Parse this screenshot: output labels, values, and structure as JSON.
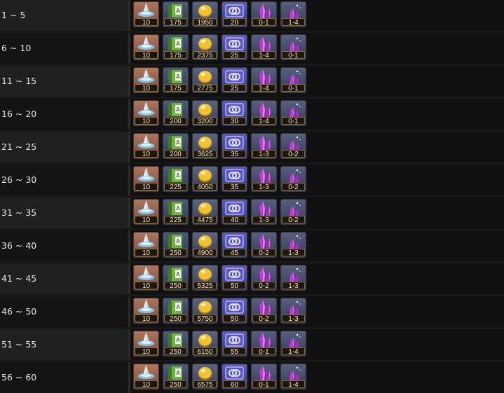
{
  "items": [
    {
      "icon": "crystal-shard-icon"
    },
    {
      "icon": "skill-book-icon"
    },
    {
      "icon": "gold-coin-icon"
    },
    {
      "icon": "portal-ticket-icon"
    },
    {
      "icon": "pink-crystal-large-icon"
    },
    {
      "icon": "pink-crystal-small-icon"
    }
  ],
  "rows": [
    {
      "range": "1 ~ 5",
      "values": [
        "10",
        "175",
        "1950",
        "20",
        "0-1",
        "1-4"
      ]
    },
    {
      "range": "6 ~ 10",
      "values": [
        "10",
        "175",
        "2375",
        "25",
        "1-4",
        "0-1"
      ]
    },
    {
      "range": "11 ~ 15",
      "values": [
        "10",
        "175",
        "2775",
        "25",
        "1-4",
        "0-1"
      ]
    },
    {
      "range": "16 ~ 20",
      "values": [
        "10",
        "200",
        "3200",
        "30",
        "1-4",
        "0-1"
      ]
    },
    {
      "range": "21 ~ 25",
      "values": [
        "10",
        "200",
        "3625",
        "35",
        "1-3",
        "0-2"
      ]
    },
    {
      "range": "26 ~ 30",
      "values": [
        "10",
        "225",
        "4050",
        "35",
        "1-3",
        "0-2"
      ]
    },
    {
      "range": "31 ~ 35",
      "values": [
        "10",
        "225",
        "4475",
        "40",
        "1-3",
        "0-2"
      ]
    },
    {
      "range": "36 ~ 40",
      "values": [
        "10",
        "250",
        "4900",
        "45",
        "0-2",
        "1-3"
      ]
    },
    {
      "range": "41 ~ 45",
      "values": [
        "10",
        "250",
        "5325",
        "50",
        "0-2",
        "1-3"
      ]
    },
    {
      "range": "46 ~ 50",
      "values": [
        "10",
        "250",
        "5750",
        "50",
        "0-2",
        "1-3"
      ]
    },
    {
      "range": "51 ~ 55",
      "values": [
        "10",
        "250",
        "6150",
        "55",
        "0-1",
        "1-4"
      ]
    },
    {
      "range": "56 ~ 60",
      "values": [
        "10",
        "250",
        "6575",
        "60",
        "0-1",
        "1-4"
      ]
    }
  ]
}
